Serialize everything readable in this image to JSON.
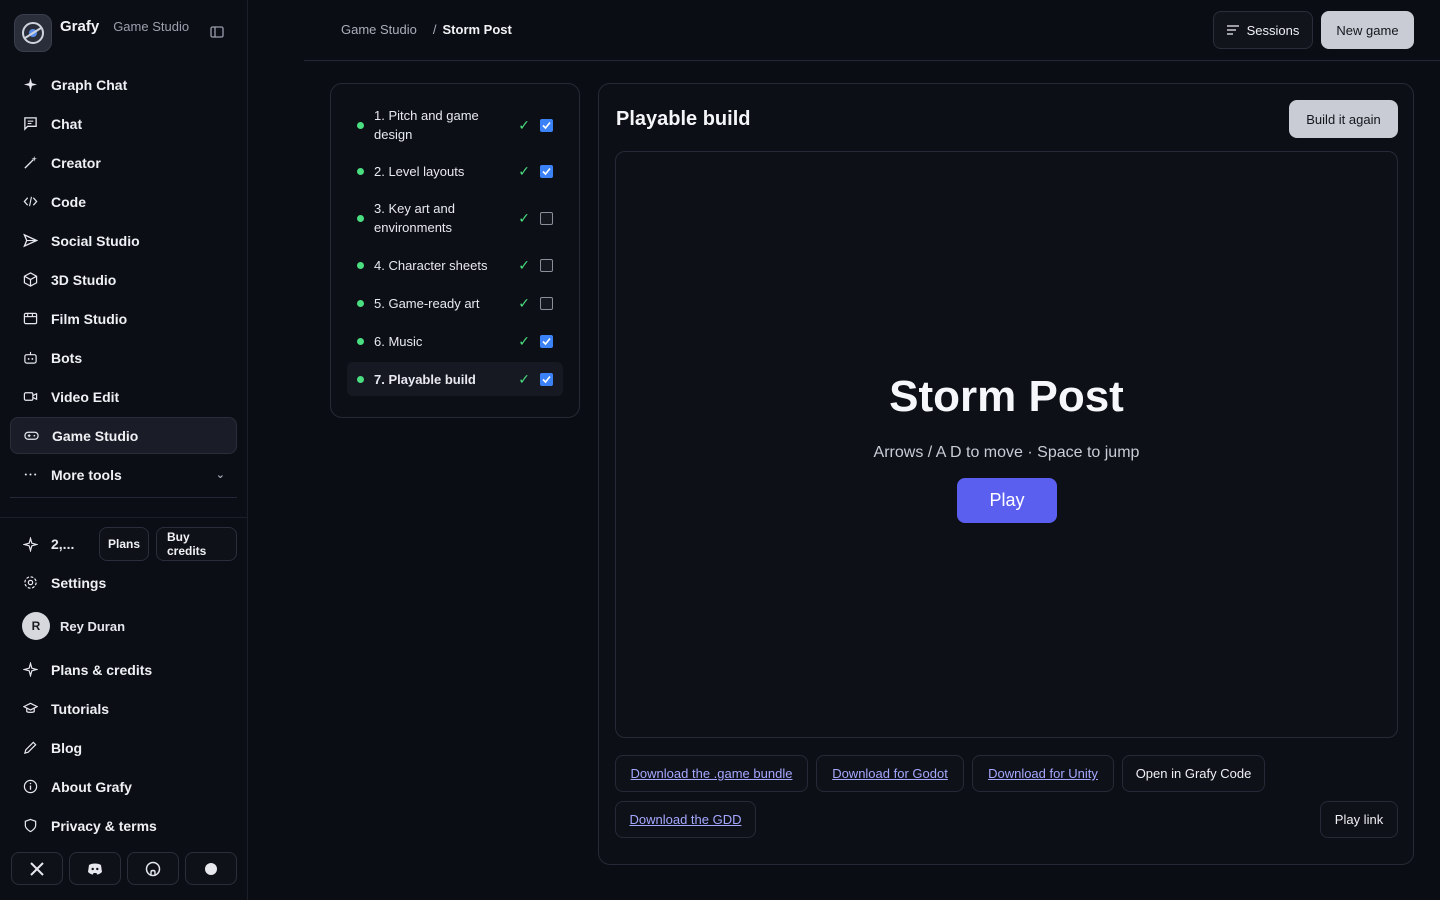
{
  "brand": {
    "name": "Grafy",
    "sub": "Game Studio"
  },
  "sidebar": {
    "items": [
      {
        "label": "Graph Chat",
        "icon": "sparkle-icon"
      },
      {
        "label": "Chat",
        "icon": "chat-icon"
      },
      {
        "label": "Creator",
        "icon": "wand-icon"
      },
      {
        "label": "Code",
        "icon": "code-icon"
      },
      {
        "label": "Social Studio",
        "icon": "send-icon"
      },
      {
        "label": "3D Studio",
        "icon": "cube-icon"
      },
      {
        "label": "Film Studio",
        "icon": "film-icon"
      },
      {
        "label": "Bots",
        "icon": "bot-icon"
      },
      {
        "label": "Video Edit",
        "icon": "video-icon"
      },
      {
        "label": "Game Studio",
        "icon": "gamepad-icon",
        "active": true
      },
      {
        "label": "More tools",
        "icon": "more-icon"
      }
    ],
    "credits_value": "2,...",
    "plans_label": "Plans",
    "buy_credits_label": "Buy credits",
    "settings_label": "Settings",
    "user": {
      "initial": "R",
      "name": "Rey Duran"
    },
    "bottom_items": [
      {
        "label": "Plans & credits",
        "icon": "sparkle-icon"
      },
      {
        "label": "Tutorials",
        "icon": "graduation-cap-icon"
      },
      {
        "label": "Blog",
        "icon": "pencil-icon"
      },
      {
        "label": "About Grafy",
        "icon": "info-icon"
      },
      {
        "label": "Privacy & terms",
        "icon": "shield-icon"
      }
    ]
  },
  "header": {
    "crumb_root": "Game Studio",
    "crumb_current": "Storm Post",
    "sessions_label": "Sessions",
    "new_game_label": "New game"
  },
  "steps": [
    {
      "label": "1. Pitch and game design",
      "checked": true
    },
    {
      "label": "2. Level layouts",
      "checked": true
    },
    {
      "label": "3. Key art and environments",
      "checked": false
    },
    {
      "label": "4. Character sheets",
      "checked": false
    },
    {
      "label": "5. Game-ready art",
      "checked": false
    },
    {
      "label": "6. Music",
      "checked": true
    },
    {
      "label": "7. Playable build",
      "checked": true,
      "active": true
    }
  ],
  "build": {
    "title": "Playable build",
    "rebuild_label": "Build it again",
    "game_title": "Storm Post",
    "game_hint": "Arrows / A D to move · Space to jump",
    "play_label": "Play",
    "download_bundle": "Download the .game bundle",
    "download_godot": "Download for Godot",
    "download_unity": "Download for Unity",
    "open_code": "Open in Grafy Code",
    "download_gdd": "Download the GDD",
    "play_link": "Play link"
  },
  "colors": {
    "accent": "#5b5ff0",
    "success": "#4ade80",
    "checkbox": "#3b82f6"
  }
}
